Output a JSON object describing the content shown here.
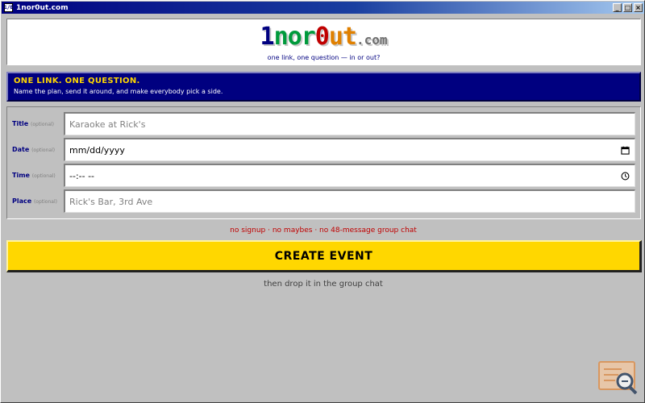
{
  "window": {
    "title": "1nor0ut.com",
    "icon": "app-icon",
    "icon_text": "1/0",
    "minimize_glyph": "_",
    "maximize_glyph": "□",
    "close_glyph": "×"
  },
  "logo": {
    "part_1": "1",
    "part_nor": "nor",
    "part_0": "0",
    "part_ut": "ut",
    "part_com": ".com",
    "tagline": "one link, one question — in or out?"
  },
  "banner": {
    "title": "ONE LINK. ONE QUESTION.",
    "subtitle": "Name the plan, send it around, and make everybody pick a side."
  },
  "form": {
    "fields": [
      {
        "label": "Title",
        "optional": "(optional)",
        "placeholder": "Karaoke at Rick's",
        "value": ""
      },
      {
        "label": "Date",
        "optional": "(optional)",
        "placeholder": "",
        "value": "mm/dd/yyyy",
        "icon": "calendar-icon"
      },
      {
        "label": "Time",
        "optional": "(optional)",
        "placeholder": "",
        "value": "--:-- --",
        "icon": "clock-icon"
      },
      {
        "label": "Place",
        "optional": "(optional)",
        "placeholder": "Rick's Bar, 3rd Ave",
        "value": ""
      }
    ]
  },
  "slogan": "no signup · no maybes · no 48-message group chat",
  "create_button": {
    "label": "CREATE EVENT"
  },
  "hint": "then drop it in the group chat",
  "colors": {
    "desktop": "#c0c0c0",
    "titlebar": "#000080",
    "banner": "#000080",
    "banner_title": "#ffd700",
    "button": "#ffd700",
    "slogan": "#c00000"
  },
  "corner_badge": {
    "icon": "search-document-icon"
  }
}
